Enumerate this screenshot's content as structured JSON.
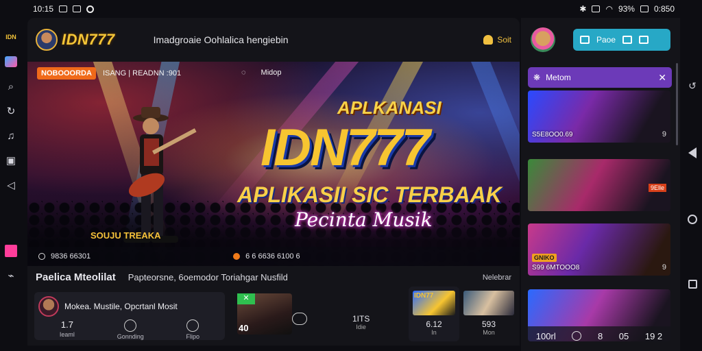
{
  "status": {
    "time_left": "10:15",
    "battery": "93%",
    "time": "0:850"
  },
  "rail": {
    "logo": "IDN"
  },
  "header": {
    "brand": "IDN777",
    "title": "Imadgroaie Oohlalica hengiebin",
    "action": "Soit"
  },
  "hero": {
    "tag": "NOBOOORDA",
    "tag_text": "ISANG | READNN :901",
    "tag_right1": "",
    "tag_right2": "Midop",
    "title1": "APLKANASI",
    "title2": "IDN777",
    "title3": "APLIKASII SIC TERBAAK",
    "title4": "Pecinta Musik",
    "badge": "SOUJU TREAKA",
    "foot1": "9836 66301",
    "foot2": "6 6  6636 6100 6",
    "colors": {
      "gold": "#f7c531",
      "pink": "#ff3aa8",
      "orange": "#f06a1a"
    }
  },
  "lower": {
    "title": "Paelica Mteolilat",
    "subtitle": "Papteorsne, 6oemodor Toriahgar Nusfild",
    "link": "Nelebrar",
    "profile": {
      "title": "Mokea. Mustile, Opcrtanl Mosit",
      "stats": [
        {
          "value": "1.7",
          "label": "Ieaml"
        },
        {
          "value": "",
          "label": "Gonnding"
        },
        {
          "value": "",
          "label": "Flipo"
        }
      ]
    },
    "thumb_a_num": "40",
    "mid_stat": {
      "value": "1ITS",
      "label": "Idie"
    },
    "thumb_b": {
      "img_text": "IDN77",
      "value": "6.12",
      "label": "In"
    },
    "thumb_c": {
      "value": "593",
      "label": "Mon"
    }
  },
  "right_panel": {
    "pill_label": "Paoe",
    "head_title": "Metom",
    "cards": [
      {
        "caption": "S5E8OO0.69",
        "badge": "9",
        "tag": "",
        "tag_r": ""
      },
      {
        "caption": "",
        "badge": "",
        "tag": "",
        "tag_r": "9Elle"
      },
      {
        "caption": "S99 6MTOOO8",
        "badge": "9",
        "tag": "GNIKO",
        "tag_r": ""
      },
      {
        "caption": "",
        "badge": "",
        "tag": "",
        "tag_r": ""
      }
    ],
    "foot": [
      "100rl",
      "8",
      "05",
      "19 2"
    ]
  }
}
